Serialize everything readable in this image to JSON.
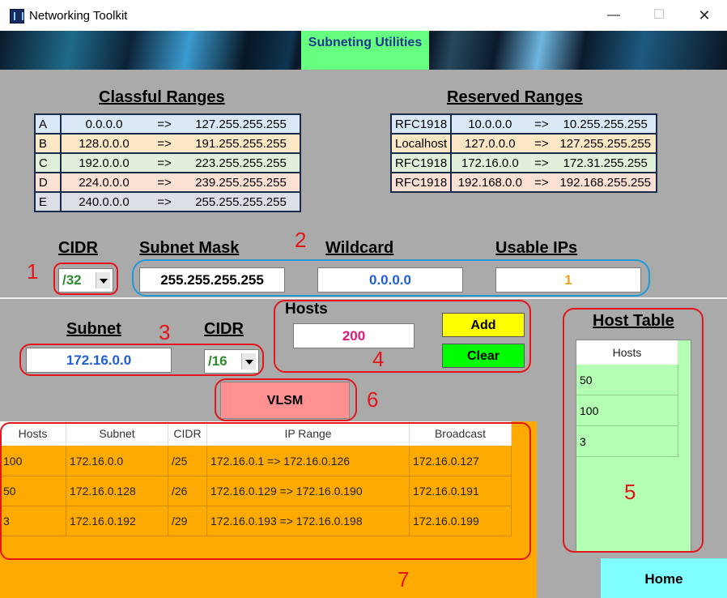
{
  "window": {
    "title": "Networking Toolkit",
    "min": "—",
    "max": "☐",
    "close": "✕"
  },
  "banner": {
    "tab_label": "Subneting Utilities"
  },
  "classful": {
    "heading": "Classful Ranges",
    "rows": [
      {
        "cls": "A",
        "start": "0.0.0.0",
        "arrow": "=>",
        "end": "127.255.255.255"
      },
      {
        "cls": "B",
        "start": "128.0.0.0",
        "arrow": "=>",
        "end": "191.255.255.255"
      },
      {
        "cls": "C",
        "start": "192.0.0.0",
        "arrow": "=>",
        "end": "223.255.255.255"
      },
      {
        "cls": "D",
        "start": "224.0.0.0",
        "arrow": "=>",
        "end": "239.255.255.255"
      },
      {
        "cls": "E",
        "start": "240.0.0.0",
        "arrow": "=>",
        "end": "255.255.255.255"
      }
    ],
    "row_colors": [
      "#dbe8f7",
      "#fde8c6",
      "#e2efda",
      "#fbe0d4",
      "#dcdfe6"
    ]
  },
  "reserved": {
    "heading": "Reserved Ranges",
    "rows": [
      {
        "name": "RFC1918",
        "start": "10.0.0.0",
        "arrow": "=>",
        "end": "10.255.255.255"
      },
      {
        "name": "Localhost",
        "start": "127.0.0.0",
        "arrow": "=>",
        "end": "127.255.255.255"
      },
      {
        "name": "RFC1918",
        "start": "172.16.0.0",
        "arrow": "=>",
        "end": "172.31.255.255"
      },
      {
        "name": "RFC1918",
        "start": "192.168.0.0",
        "arrow": "=>",
        "end": "192.168.255.255"
      }
    ],
    "row_colors": [
      "#dbe8f7",
      "#fde8c6",
      "#e2efda",
      "#fbe0d4"
    ]
  },
  "calc": {
    "cidr_label": "CIDR",
    "cidr_value": "/32",
    "mask_label": "Subnet Mask",
    "mask_value": "255.255.255.255",
    "wildcard_label": "Wildcard",
    "wildcard_value": "0.0.0.0",
    "usable_label": "Usable IPs",
    "usable_value": "1"
  },
  "vlsm_input": {
    "subnet_label": "Subnet",
    "subnet_value": "172.16.0.0",
    "cidr_label": "CIDR",
    "cidr_value": "/16",
    "hosts_label": "Hosts",
    "hosts_value": "200",
    "add_label": "Add",
    "clear_label": "Clear",
    "vlsm_label": "VLSM"
  },
  "host_table": {
    "heading": "Host Table",
    "column": "Hosts",
    "rows": [
      "50",
      "100",
      "3"
    ]
  },
  "result_table": {
    "columns": [
      "Hosts",
      "Subnet",
      "CIDR",
      "IP Range",
      "Broadcast"
    ],
    "rows": [
      [
        "100",
        "172.16.0.0",
        "/25",
        "172.16.0.1 => 172.16.0.126",
        "172.16.0.127"
      ],
      [
        "50",
        "172.16.0.128",
        "/26",
        "172.16.0.129 => 172.16.0.190",
        "172.16.0.191"
      ],
      [
        "3",
        "172.16.0.192",
        "/29",
        "172.16.0.193 => 172.16.0.198",
        "172.16.0.199"
      ]
    ]
  },
  "annotations": [
    "1",
    "2",
    "3",
    "4",
    "5",
    "6",
    "7"
  ],
  "home_label": "Home",
  "colors": {
    "accent_blue": "#1f5fd6",
    "usable_orange": "#f0a020",
    "hosts_pink": "#e0197a",
    "cidr_green": "#2d8c2d",
    "add_yellow": "#ffff00",
    "clear_green": "#00ff00",
    "vlsm_pink": "#ff9090",
    "result_orange": "#ffaa00",
    "host_green": "#b3ffb3",
    "home_cyan": "#7fffff",
    "annotation_red": "#e3161b"
  }
}
